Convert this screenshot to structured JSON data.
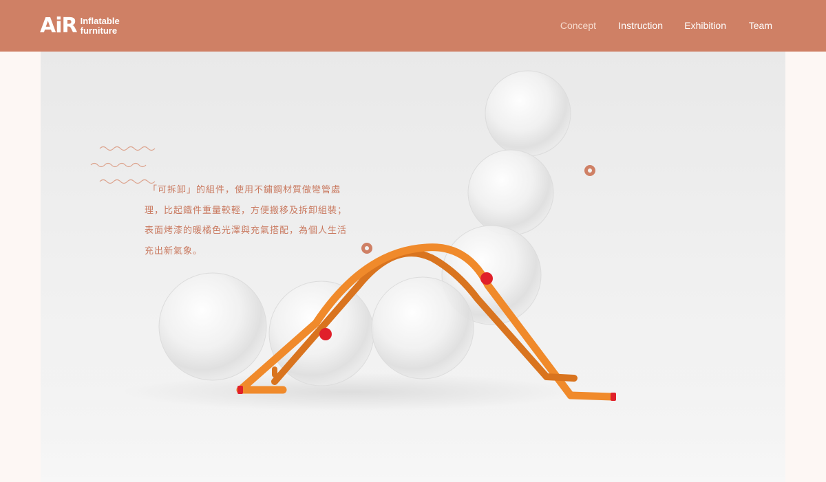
{
  "header": {
    "logo_mark": "AiR",
    "logo_line1": "Inflatable",
    "logo_line2": "furniture",
    "nav": [
      {
        "label": "Concept",
        "active": true
      },
      {
        "label": "Instruction",
        "active": false
      },
      {
        "label": "Exhibition",
        "active": false
      },
      {
        "label": "Team",
        "active": false
      }
    ]
  },
  "concept": {
    "lines": [
      "「可拆卸」的組件，使用不鏽鋼材質做彎管處",
      "理，比起鐵件重量較輕，方便搬移及拆卸組裝；",
      "表面烤漆的暖橘色光澤與充氣搭配，為個人生活",
      "充出新氣象。"
    ]
  },
  "colors": {
    "header_bg": "#cf8065",
    "page_bg": "#fdf7f4",
    "accent_text": "#c9795f",
    "frame_orange": "#f08a2b",
    "joint_red": "#e0202a"
  },
  "icons": {
    "hotspot": "hotspot-dot-icon",
    "wave": "wave-decoration-icon"
  }
}
